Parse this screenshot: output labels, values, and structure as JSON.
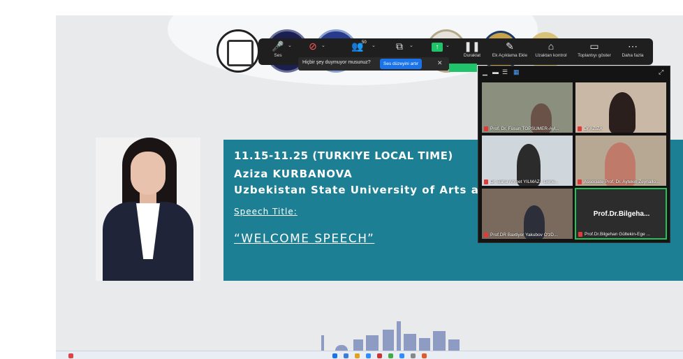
{
  "toolbar": {
    "audio_label": "Ses",
    "participants_count": "50",
    "pause_label": "Duraklat",
    "annotate_label": "Ek Açıklama Ekle",
    "remote_label": "Uzaktan kontrol",
    "show_meeting_label": "Toplantıyı göster",
    "more_label": "Daha fazla"
  },
  "notification": {
    "text": "Hiçbir şey duymuyor musunuz?",
    "button": "Ses düzeyini artır"
  },
  "slide": {
    "time": "11.15-11.25 (TURKIYE LOCAL TIME)",
    "speaker": "Aziza KURBANOVA",
    "university": "Uzbekistan State University of Arts a",
    "speech_title_label": "Speech Title:",
    "speech_title": "“WELCOME SPEECH”"
  },
  "gallery": {
    "tiles": [
      {
        "label": "Prof. Dr. Füsun TOPSÜMER-Ayl..."
      },
      {
        "label": "Dr AZIZA"
      },
      {
        "label": "Dr. Baha Ahmet YILMAZ - Gene..."
      },
      {
        "label": "Associate Prof. Dr. Aytekin Zeynallo..."
      },
      {
        "label": "Prof.DR Baxtiyor Yakubov O'zD..."
      },
      {
        "label": "Prof.Dr.Bilgehan Gültekin-Ege ...",
        "name": "Prof.Dr.Bilgeha..."
      }
    ]
  },
  "colors": {
    "banner": "#1d7f93",
    "toolbar": "#1f1f1f",
    "accent_blue": "#1a73e8",
    "active_green": "#23c35a"
  }
}
